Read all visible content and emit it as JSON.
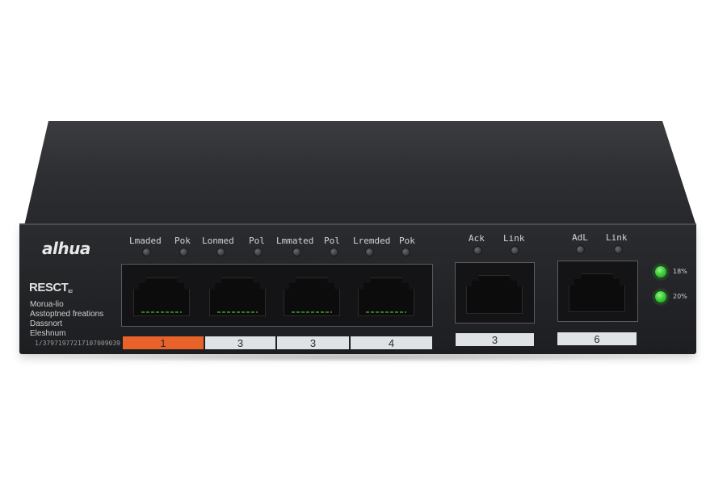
{
  "device": {
    "brand": "alhua",
    "model_logo": "RESCT",
    "model_logo_sup": "ltd",
    "info_lines": [
      "Morua-lio",
      "Asstoptned freations",
      "Dassnort",
      "Eleshnum"
    ],
    "serial": "1/37971977217107009039"
  },
  "poe_group": {
    "led_labels": [
      "Lmaded",
      "Pok",
      "Lonmed",
      "Pol",
      "Lmmated",
      "Pol",
      "Lremded",
      "Pok"
    ],
    "port_labels": [
      "1",
      "3",
      "3",
      "4"
    ]
  },
  "uplink_1": {
    "led_labels": [
      "Ack",
      "Link"
    ],
    "port_label": "3"
  },
  "uplink_2": {
    "led_labels": [
      "AdL",
      "Link"
    ],
    "port_label": "6"
  },
  "status_leds": [
    {
      "label": "18%",
      "state": "on"
    },
    {
      "label": "20%",
      "state": "on"
    }
  ],
  "colors": {
    "poe_port_label": "#e8622a",
    "port_label": "#dfe3e6",
    "status_led": "#3fcf3a",
    "body": "#2a2c2f"
  }
}
